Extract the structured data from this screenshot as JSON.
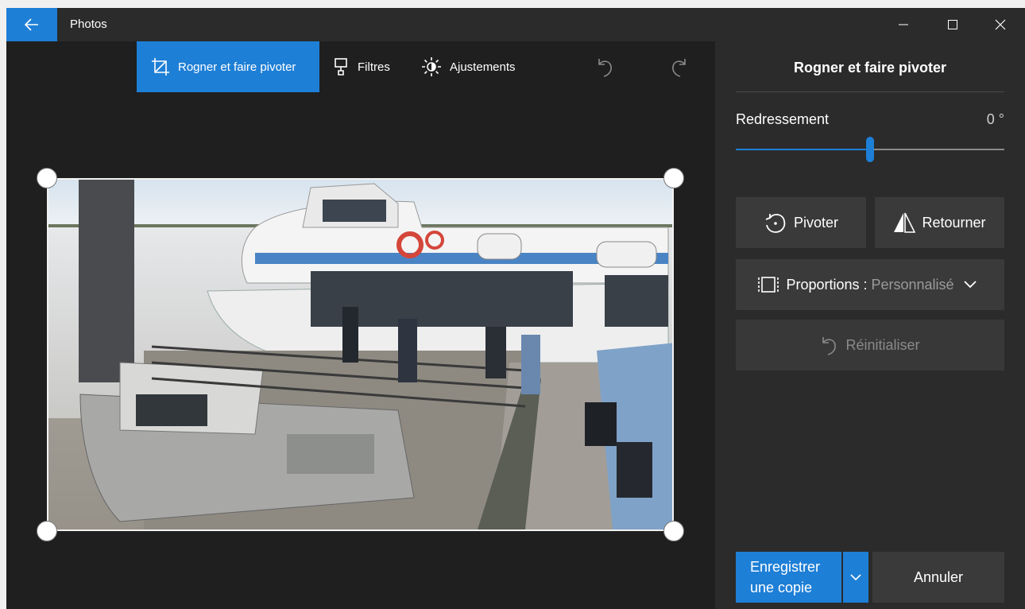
{
  "window": {
    "title": "Photos",
    "controls": {
      "minimize_icon": "minimize-icon",
      "maximize_icon": "maximize-icon",
      "close_icon": "close-icon"
    },
    "back_icon": "back-arrow-icon"
  },
  "toolbar": {
    "crop_rotate_label": "Rogner et faire pivoter",
    "filters_label": "Filtres",
    "adjustments_label": "Ajustements",
    "undo_icon": "undo-icon",
    "redo_icon": "redo-icon"
  },
  "panel": {
    "title": "Rogner et faire pivoter",
    "straighten_label": "Redressement",
    "straighten_value": "0 °",
    "straighten_fraction": 0.5,
    "rotate_label": "Pivoter",
    "flip_label": "Retourner",
    "aspect_label": "Proportions :",
    "aspect_value": "Personnalisé",
    "reset_label": "Réinitialiser",
    "save_copy_line1": "Enregistrer",
    "save_copy_line2": "une copie",
    "cancel_label": "Annuler"
  },
  "colors": {
    "accent": "#1e7fd6",
    "window_bg": "#1f1f1f",
    "panel_bg": "#2b2b2b",
    "button_bg": "#3a3a3a",
    "disabled_text": "#8a8a8a"
  }
}
